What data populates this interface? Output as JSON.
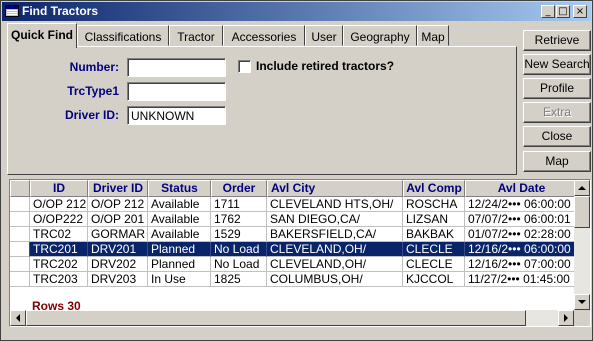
{
  "window": {
    "title": "Find Tractors",
    "minimize": "_",
    "maximize": "□",
    "close": "×"
  },
  "tabs": [
    "Quick Find",
    "Classifications",
    "Tractor",
    "Accessories",
    "User",
    "Geography",
    "Map"
  ],
  "active_tab": "Quick Find",
  "form": {
    "number_label": "Number:",
    "number_value": "",
    "trctype_label": "TrcType1",
    "trctype_value": "",
    "driver_label": "Driver ID:",
    "driver_value": "UNKNOWN",
    "retired_label": "Include retired tractors?",
    "retired_checked": false
  },
  "buttons": {
    "retrieve": "Retrieve",
    "new_search": "New Search",
    "profile": "Profile",
    "extra": "Extra",
    "close": "Close",
    "map": "Map"
  },
  "grid": {
    "columns": [
      "ID",
      "Driver ID",
      "Status",
      "Order",
      "Avl City",
      "Avl Comp",
      "Avl Date"
    ],
    "rows": [
      [
        "O/OP 212",
        "O/OP 212",
        "Available",
        "1711",
        "CLEVELAND HTS,OH/",
        "ROSCHA",
        "12/24/2••• 06:00:00"
      ],
      [
        "O/OP222",
        "O/OP 201",
        "Available",
        "1762",
        "SAN DIEGO,CA/",
        "LIZSAN",
        "07/07/2••• 06:00:01"
      ],
      [
        "TRC02",
        "GORMAR",
        "Available",
        "1529",
        "BAKERSFIELD,CA/",
        "BAKBAK",
        "01/07/2••• 02:28:00"
      ],
      [
        "TRC201",
        "DRV201",
        "Planned",
        "No Load",
        "CLEVELAND,OH/",
        "CLECLE",
        "12/16/2••• 06:00:00"
      ],
      [
        "TRC202",
        "DRV202",
        "Planned",
        "No Load",
        "CLEVELAND,OH/",
        "CLECLE",
        "12/16/2••• 07:00:00"
      ],
      [
        "TRC203",
        "DRV203",
        "In Use",
        "1825",
        "COLUMBUS,OH/",
        "KJCCOL",
        "11/27/2••• 01:45:00"
      ]
    ],
    "selected_row": 3,
    "row_count": "Rows 30"
  },
  "colors": {
    "title_bar": "#0a246a",
    "label_blue": "#000080",
    "selected_row": "#0a246a",
    "rowcount_red": "#800000"
  }
}
